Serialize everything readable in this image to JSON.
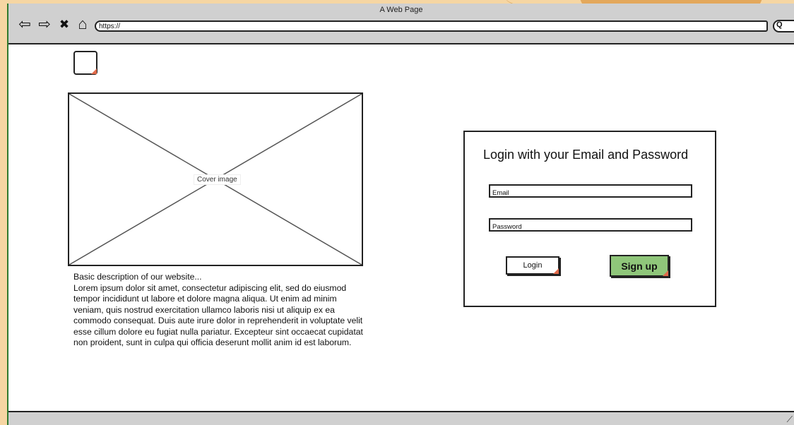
{
  "browser": {
    "window_title": "A Web Page",
    "url": "https://",
    "nav": {
      "back_glyph": "⇦",
      "forward_glyph": "⇨",
      "stop_glyph": "✖",
      "home_glyph": "⌂"
    },
    "search_glyph": "Q"
  },
  "logo": {
    "icon": "image-placeholder-icon"
  },
  "cover": {
    "label": "Cover image"
  },
  "description": {
    "heading": "Basic description of our website...",
    "body": "Lorem ipsum dolor sit amet, consectetur adipiscing elit, sed do eiusmod tempor incididunt ut labore et dolore magna aliqua. Ut enim ad minim veniam, quis nostrud exercitation ullamco laboris nisi ut aliquip ex ea commodo consequat. Duis aute irure dolor in reprehenderit in voluptate velit esse cillum dolore eu fugiat nulla pariatur. Excepteur sint occaecat cupidatat non proident, sunt in culpa qui officia deserunt mollit anim id est laborum."
  },
  "login": {
    "title": "Login with your Email and Password",
    "email_placeholder": "Email",
    "password_placeholder": "Password",
    "login_label": "Login",
    "signup_label": "Sign up"
  },
  "colors": {
    "signup_button": "#8fc67a",
    "chrome": "#d0d0d0",
    "backdrop": "#f6d6a3"
  }
}
